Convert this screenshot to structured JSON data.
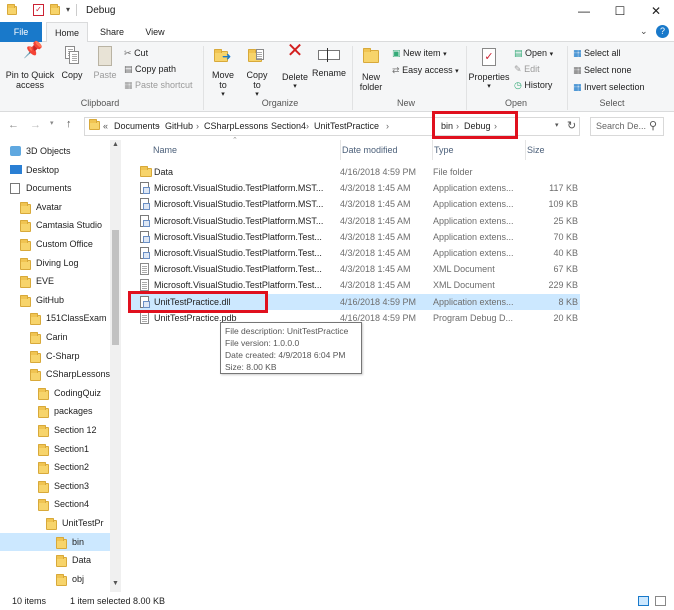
{
  "window": {
    "title": "Debug"
  },
  "tabs": {
    "file": "File",
    "home": "Home",
    "share": "Share",
    "view": "View"
  },
  "ribbon": {
    "clipboard": {
      "pin": "Pin to Quick access",
      "copy": "Copy",
      "paste": "Paste",
      "cut": "Cut",
      "copy_path": "Copy path",
      "paste_shortcut": "Paste shortcut",
      "label": "Clipboard"
    },
    "organize": {
      "move_to": "Move to",
      "copy_to": "Copy to",
      "delete": "Delete",
      "rename": "Rename",
      "label": "Organize"
    },
    "new": {
      "new_folder": "New folder",
      "new_item": "New item",
      "easy_access": "Easy access",
      "label": "New"
    },
    "open": {
      "properties": "Properties",
      "open": "Open",
      "edit": "Edit",
      "history": "History",
      "label": "Open"
    },
    "select": {
      "select_all": "Select all",
      "select_none": "Select none",
      "invert": "Invert selection",
      "label": "Select"
    }
  },
  "address": {
    "crumbs": [
      "Documents",
      "GitHub",
      "CSharpLessons",
      "Section4",
      "UnitTestPractice",
      "bin",
      "Debug"
    ],
    "overflow": "«",
    "search_placeholder": "Search De..."
  },
  "nav": {
    "items": [
      {
        "label": "3D Objects",
        "icon": "3d-objects-icon"
      },
      {
        "label": "Desktop",
        "icon": "desktop-icon"
      },
      {
        "label": "Documents",
        "icon": "documents-icon"
      },
      {
        "label": "Avatar"
      },
      {
        "label": "Camtasia Studio"
      },
      {
        "label": "Custom Office"
      },
      {
        "label": "Diving Log"
      },
      {
        "label": "EVE"
      },
      {
        "label": "GitHub"
      },
      {
        "label": "151ClassExam"
      },
      {
        "label": "Carin"
      },
      {
        "label": "C-Sharp"
      },
      {
        "label": "CSharpLessons"
      },
      {
        "label": "CodingQuiz"
      },
      {
        "label": "packages"
      },
      {
        "label": "Section 12"
      },
      {
        "label": "Section1"
      },
      {
        "label": "Section2"
      },
      {
        "label": "Section3"
      },
      {
        "label": "Section4"
      },
      {
        "label": "UnitTestPr"
      },
      {
        "label": "bin",
        "selected": true
      },
      {
        "label": "Data"
      },
      {
        "label": "obj"
      }
    ]
  },
  "columns": {
    "name": "Name",
    "date": "Date modified",
    "type": "Type",
    "size": "Size"
  },
  "files": [
    {
      "name": "Data",
      "date": "4/16/2018 4:59 PM",
      "type": "File folder",
      "size": "",
      "icon": "folder-icon"
    },
    {
      "name": "Microsoft.VisualStudio.TestPlatform.MST...",
      "date": "4/3/2018 1:45 AM",
      "type": "Application extens...",
      "size": "117 KB",
      "icon": "dll-icon"
    },
    {
      "name": "Microsoft.VisualStudio.TestPlatform.MST...",
      "date": "4/3/2018 1:45 AM",
      "type": "Application extens...",
      "size": "109 KB",
      "icon": "dll-icon"
    },
    {
      "name": "Microsoft.VisualStudio.TestPlatform.MST...",
      "date": "4/3/2018 1:45 AM",
      "type": "Application extens...",
      "size": "25 KB",
      "icon": "dll-icon"
    },
    {
      "name": "Microsoft.VisualStudio.TestPlatform.Test...",
      "date": "4/3/2018 1:45 AM",
      "type": "Application extens...",
      "size": "70 KB",
      "icon": "dll-icon"
    },
    {
      "name": "Microsoft.VisualStudio.TestPlatform.Test...",
      "date": "4/3/2018 1:45 AM",
      "type": "Application extens...",
      "size": "40 KB",
      "icon": "dll-icon"
    },
    {
      "name": "Microsoft.VisualStudio.TestPlatform.Test...",
      "date": "4/3/2018 1:45 AM",
      "type": "XML Document",
      "size": "67 KB",
      "icon": "xml-icon"
    },
    {
      "name": "Microsoft.VisualStudio.TestPlatform.Test...",
      "date": "4/3/2018 1:45 AM",
      "type": "XML Document",
      "size": "229 KB",
      "icon": "xml-icon"
    },
    {
      "name": "UnitTestPractice.dll",
      "date": "4/16/2018 4:59 PM",
      "type": "Application extens...",
      "size": "8 KB",
      "icon": "dll-icon",
      "selected": true
    },
    {
      "name": "UnitTestPractice.pdb",
      "date": "4/16/2018 4:59 PM",
      "type": "Program Debug D...",
      "size": "20 KB",
      "icon": "pdb-icon"
    }
  ],
  "tooltip": {
    "lines": [
      "File description: UnitTestPractice",
      "File version: 1.0.0.0",
      "Date created: 4/9/2018 6:04 PM",
      "Size: 8.00 KB"
    ]
  },
  "status": {
    "items": "10 items",
    "selected": "1 item selected  8.00 KB"
  },
  "colors": {
    "accent": "#1979ca",
    "highlight": "#cce8ff",
    "annotation": "#e0101e"
  }
}
